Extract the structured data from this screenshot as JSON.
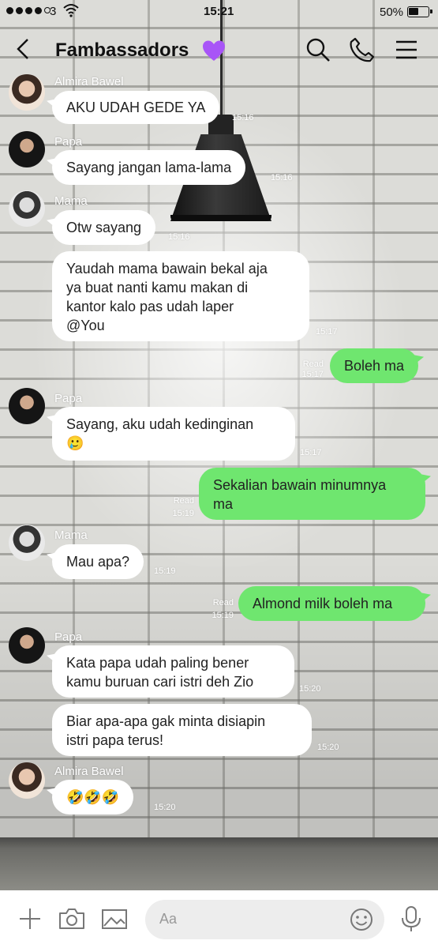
{
  "status_bar": {
    "carrier": "3",
    "time": "15:21",
    "battery": "50%"
  },
  "header": {
    "title": "Fambassadors",
    "title_emoji": "purple-heart"
  },
  "messages": [
    {
      "sender": "Almira Bawel",
      "text": "AKU UDAH GEDE YA",
      "time": "15:16"
    },
    {
      "sender": "Papa",
      "text": "Sayang jangan lama-lama",
      "time": "15:16"
    },
    {
      "sender": "Mama",
      "text": "Otw sayang",
      "time": "15:16"
    },
    {
      "text": "Yaudah mama bawain bekal aja\nya buat nanti kamu makan di\nkantor kalo pas udah laper\n@You",
      "time": "15:17"
    },
    {
      "outgoing": true,
      "text": "Boleh ma",
      "read": "Read",
      "time": "15:17"
    },
    {
      "sender": "Papa",
      "text": "Sayang, aku udah kedinginan\n🥲",
      "time": "15:17"
    },
    {
      "outgoing": true,
      "text": "Sekalian bawain minumnya\nma",
      "read": "Read",
      "time": "15:19"
    },
    {
      "sender": "Mama",
      "text": "Mau apa?",
      "time": "15:19"
    },
    {
      "outgoing": true,
      "text": "Almond milk boleh ma",
      "read": "Read",
      "time": "15:19"
    },
    {
      "sender": "Papa",
      "text": "Kata papa udah paling bener\nkamu buruan cari istri deh Zio",
      "time": "15:20"
    },
    {
      "text": "Biar apa-apa gak minta disiapin\nistri papa terus!",
      "time": "15:20"
    },
    {
      "sender": "Almira Bawel",
      "text": "🤣🤣🤣",
      "time": "15:20"
    }
  ],
  "input": {
    "placeholder": "Aa"
  },
  "colors": {
    "outgoing_bubble": "#6fe66f",
    "incoming_bubble": "#ffffff",
    "heart": "#a855f7"
  }
}
